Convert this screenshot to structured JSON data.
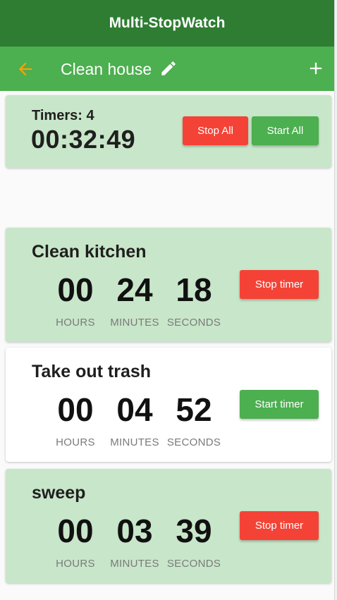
{
  "app": {
    "title": "Multi-StopWatch"
  },
  "toolbar": {
    "list_name": "Clean house"
  },
  "summary": {
    "timers_label": "Timers: 4",
    "total_time": "00:32:49",
    "stop_all_label": "Stop All",
    "start_all_label": "Start All"
  },
  "units": {
    "hours": "HOURS",
    "minutes": "MINUTES",
    "seconds": "SECONDS"
  },
  "timers": [
    {
      "name": "Clean kitchen",
      "hours": "00",
      "minutes": "24",
      "seconds": "18",
      "button_label": "Stop timer",
      "running": true
    },
    {
      "name": "Take out trash",
      "hours": "00",
      "minutes": "04",
      "seconds": "52",
      "button_label": "Start timer",
      "running": false
    },
    {
      "name": "sweep",
      "hours": "00",
      "minutes": "03",
      "seconds": "39",
      "button_label": "Stop timer",
      "running": true
    }
  ],
  "icons": {
    "back": "arrow-back-icon",
    "edit": "pencil-icon",
    "add": "plus-icon"
  },
  "colors": {
    "title_bar": "#2e7d32",
    "toolbar": "#4caf50",
    "running_card": "#c8e6c9",
    "stop": "#f44336",
    "start": "#4caf50",
    "back_arrow": "#ffa000"
  }
}
